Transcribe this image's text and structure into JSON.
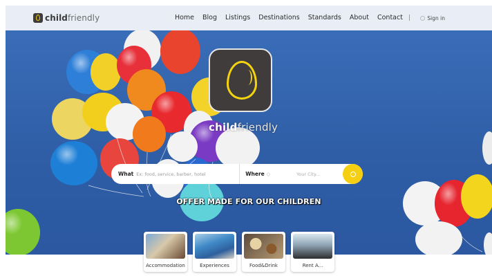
{
  "brand": {
    "name_bold": "child",
    "name_light": "friendly"
  },
  "nav": {
    "items": [
      "Home",
      "Blog",
      "Listings",
      "Destinations",
      "Standards",
      "About",
      "Contact"
    ],
    "separator": "|",
    "signin": "Sign in"
  },
  "hero": {
    "brand_bold": "child",
    "brand_light": "friendly",
    "tagline": "OFFER MADE FOR OUR CHILDREN"
  },
  "search": {
    "what_label": "What",
    "what_placeholder": "Ex: food, service, barber, hotel",
    "where_label": "Where",
    "where_placeholder": "Your City..."
  },
  "categories": [
    {
      "label": "Accommodation"
    },
    {
      "label": "Experiences"
    },
    {
      "label": "Food&Drink"
    },
    {
      "label": "Rent A..."
    }
  ],
  "colors": {
    "accent": "#f6cf12",
    "hero_bg": "#2f5ea6",
    "header_bg": "#e9eef6",
    "logo_dark": "#3f3c3b"
  }
}
